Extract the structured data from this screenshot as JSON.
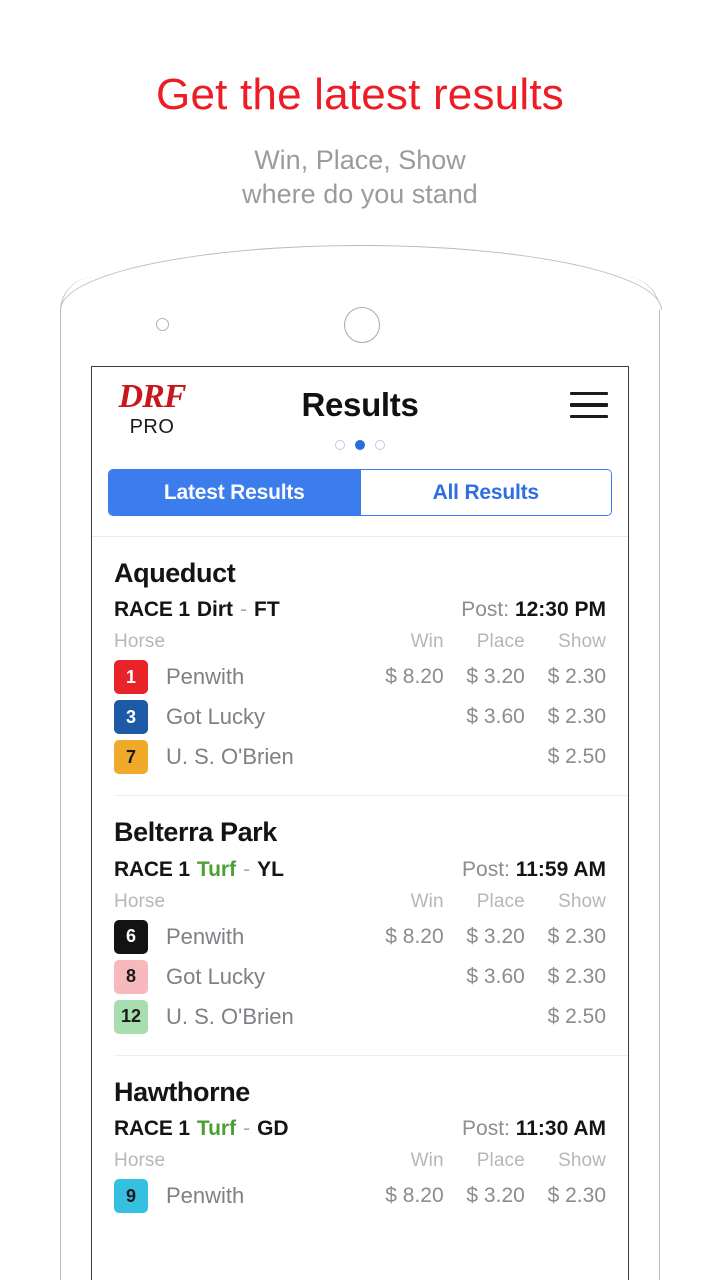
{
  "promo": {
    "title": "Get the latest results",
    "subtitle_line1": "Win, Place, Show",
    "subtitle_line2": "where do you stand"
  },
  "app": {
    "logo_primary": "DRF",
    "logo_secondary": "PRO",
    "title": "Results",
    "menu_icon": "hamburger-menu-icon",
    "pager": {
      "count": 3,
      "active_index": 1
    }
  },
  "tabs": [
    {
      "label": "Latest Results",
      "active": true
    },
    {
      "label": "All Results",
      "active": false
    }
  ],
  "columns": {
    "horse": "Horse",
    "win": "Win",
    "place": "Place",
    "show": "Show"
  },
  "labels": {
    "post": "Post:",
    "race_prefix": "RACE",
    "separator": "-"
  },
  "colors": {
    "accent_blue": "#3b7ded",
    "brand_red": "#c9161d",
    "promo_red": "#ee1c25",
    "turf_green": "#4ca033",
    "muted_gray": "#8b8b90"
  },
  "races": [
    {
      "track": "Aqueduct",
      "race_number": "1",
      "surface": "Dirt",
      "surface_type": "dirt",
      "condition": "FT",
      "post_time": "12:30 PM",
      "entries": [
        {
          "number": "1",
          "name": "Penwith",
          "win": "$ 8.20",
          "place": "$ 3.20",
          "show": "$ 2.30",
          "badge_bg": "#e8242a",
          "badge_fg": "#ffffff"
        },
        {
          "number": "3",
          "name": "Got Lucky",
          "win": "",
          "place": "$ 3.60",
          "show": "$ 2.30",
          "badge_bg": "#1c5aa8",
          "badge_fg": "#ffffff"
        },
        {
          "number": "7",
          "name": "U. S. O'Brien",
          "win": "",
          "place": "",
          "show": "$ 2.50",
          "badge_bg": "#f0a92a",
          "badge_fg": "#1a1a1a"
        }
      ]
    },
    {
      "track": "Belterra Park",
      "race_number": "1",
      "surface": "Turf",
      "surface_type": "turf",
      "condition": "YL",
      "post_time": "11:59 AM",
      "entries": [
        {
          "number": "6",
          "name": "Penwith",
          "win": "$ 8.20",
          "place": "$ 3.20",
          "show": "$ 2.30",
          "badge_bg": "#131316",
          "badge_fg": "#ffffff"
        },
        {
          "number": "8",
          "name": "Got Lucky",
          "win": "",
          "place": "$ 3.60",
          "show": "$ 2.30",
          "badge_bg": "#f7b8be",
          "badge_fg": "#1a1a1a"
        },
        {
          "number": "12",
          "name": "U. S. O'Brien",
          "win": "",
          "place": "",
          "show": "$ 2.50",
          "badge_bg": "#a8ddb0",
          "badge_fg": "#1a1a1a"
        }
      ]
    },
    {
      "track": "Hawthorne",
      "race_number": "1",
      "surface": "Turf",
      "surface_type": "turf",
      "condition": "GD",
      "post_time": "11:30 AM",
      "entries": [
        {
          "number": "9",
          "name": "Penwith",
          "win": "$ 8.20",
          "place": "$ 3.20",
          "show": "$ 2.30",
          "badge_bg": "#35c0df",
          "badge_fg": "#1a1a1a"
        }
      ]
    }
  ]
}
